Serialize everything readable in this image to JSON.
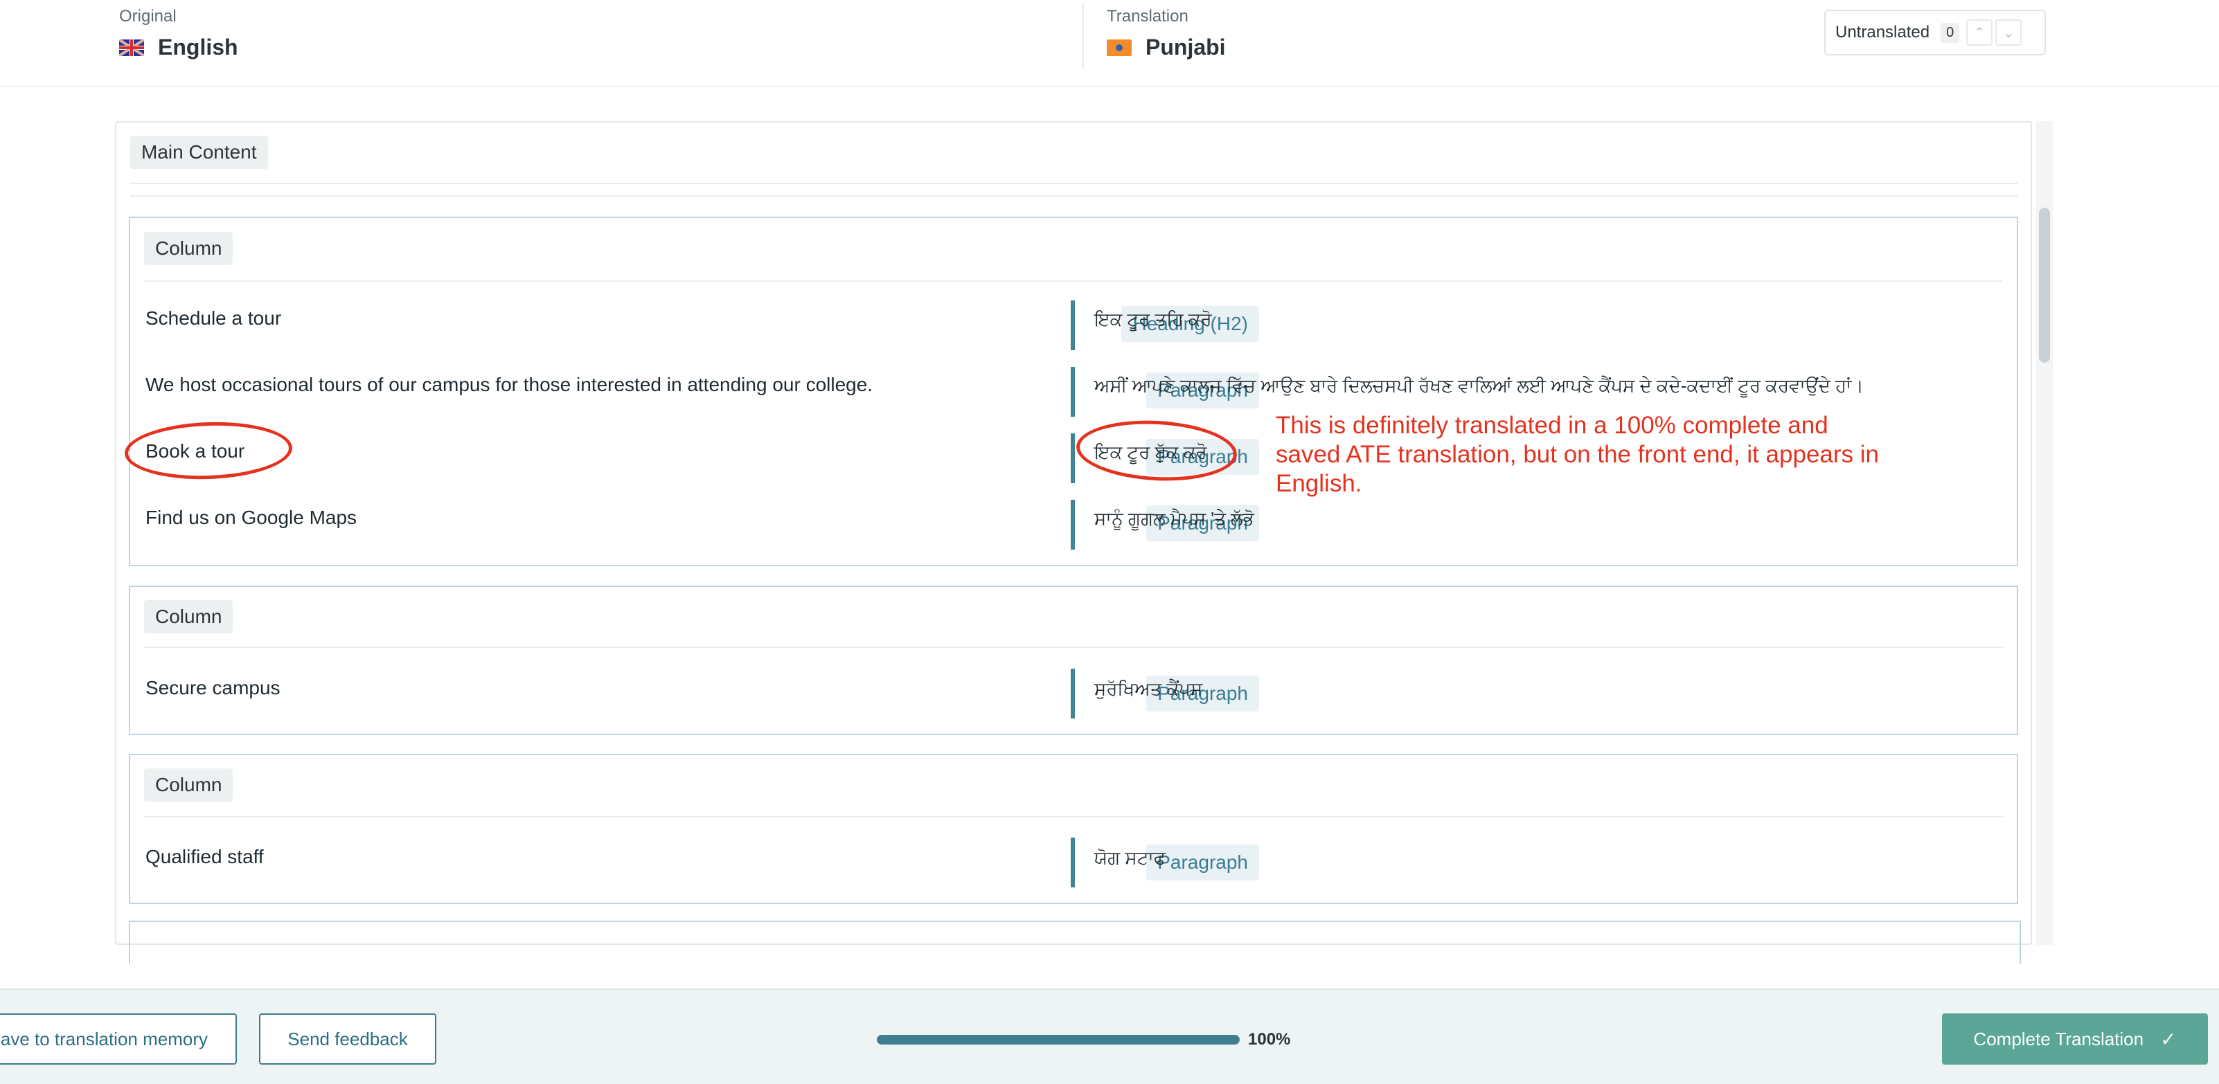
{
  "header": {
    "original": {
      "caption": "Original",
      "language": "English",
      "flag": "uk-flag-icon"
    },
    "translation": {
      "caption": "Translation",
      "language": "Punjabi",
      "flag": "pa-flag-icon"
    },
    "filter": {
      "label": "Untranslated",
      "count": "0"
    }
  },
  "main": {
    "section_label": "Main Content",
    "columns": [
      {
        "label": "Column",
        "rows": [
          {
            "source": "Schedule a tour",
            "type": "Heading (H2)",
            "target": "ਇਕ ਟੂਰ ਤਹਿ ਕਰੋ"
          },
          {
            "source": "We host occasional tours of our campus for those interested in attending our college.",
            "type": "Paragraph",
            "target": "ਅਸੀਂ ਆਪਣੇ ਕਾਲਜ ਵਿੱਚ ਆਉਣ ਬਾਰੇ ਦਿਲਚਸਪੀ ਰੱਖਣ ਵਾਲਿਆਂ ਲਈ ਆਪਣੇ ਕੈਂਪਸ ਦੇ ਕਦੇ-ਕਦਾਈਂ ਟੂਰ ਕਰਵਾਉਂਦੇ ਹਾਂ।"
          },
          {
            "source": "Book a tour",
            "type": "Paragraph",
            "target": "ਇਕ ਟੂਰ ਬੁੱਕ ਕਰੋ"
          },
          {
            "source": "Find us on Google Maps",
            "type": "Paragraph",
            "target": "ਸਾਨੂੰ ਗੂਗਲ ਮੈਪਸ 'ਤੇ ਲੱਭੋ"
          }
        ]
      },
      {
        "label": "Column",
        "rows": [
          {
            "source": "Secure campus",
            "type": "Paragraph",
            "target": "ਸੁਰੱਖਿਅਤ ਕੈਂਪਸ"
          }
        ]
      },
      {
        "label": "Column",
        "rows": [
          {
            "source": "Qualified staff",
            "type": "Paragraph",
            "target": "ਯੋਗ ਸਟਾਫ"
          }
        ]
      }
    ]
  },
  "annotation": {
    "text": "This is definitely translated in a 100% complete and saved ATE translation, but on the front end, it appears in English.",
    "color": "#e4321f"
  },
  "footer": {
    "save_tm_label": "ave to translation memory",
    "feedback_label": "Send feedback",
    "progress_value": 100,
    "progress_label": "100%",
    "complete_label": "Complete Translation",
    "complete_icon": "check-icon"
  },
  "colors": {
    "accent": "#3f8497",
    "complete_button": "#5ba696",
    "column_border": "#b9d7dc"
  }
}
